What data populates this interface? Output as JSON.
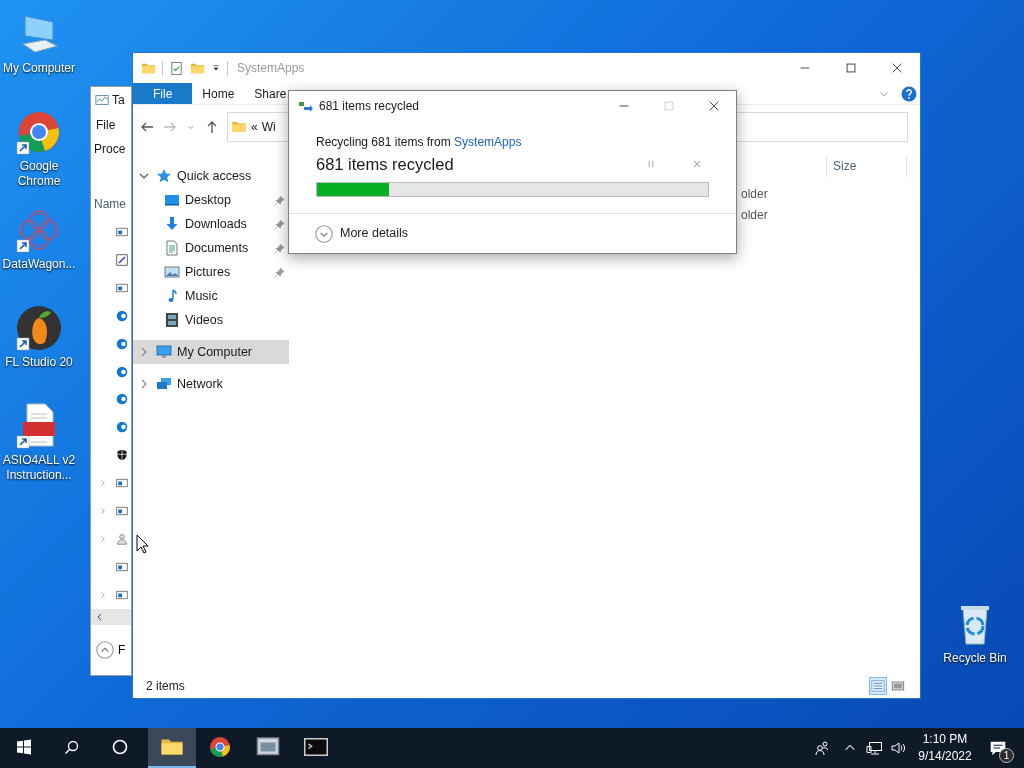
{
  "desktop_icons": [
    {
      "label": "My Computer",
      "kind": "computer",
      "shortcut": false
    },
    {
      "label": "Google Chrome",
      "kind": "chrome",
      "shortcut": true
    },
    {
      "label": "DataWagon...",
      "kind": "pattern",
      "shortcut": true
    },
    {
      "label": "FL Studio 20",
      "kind": "fruit",
      "shortcut": true
    },
    {
      "label": "ASIO4ALL v2 Instruction...",
      "kind": "pdf",
      "shortcut": true
    }
  ],
  "recycle_bin": {
    "label": "Recycle Bin",
    "kind": "recycle"
  },
  "task_manager": {
    "title": "Ta",
    "menu": "File",
    "tab": "Proce",
    "column": "Name",
    "rows": [
      {
        "kind": "app",
        "expandable": false
      },
      {
        "kind": "edit",
        "expandable": false
      },
      {
        "kind": "app",
        "expandable": false
      },
      {
        "kind": "browser",
        "expandable": false
      },
      {
        "kind": "browser",
        "expandable": false
      },
      {
        "kind": "browser",
        "expandable": false
      },
      {
        "kind": "browser",
        "expandable": false
      },
      {
        "kind": "browser",
        "expandable": false
      },
      {
        "kind": "shield",
        "expandable": false
      },
      {
        "kind": "app",
        "expandable": true
      },
      {
        "kind": "app",
        "expandable": true
      },
      {
        "kind": "user",
        "expandable": true
      },
      {
        "kind": "app",
        "expandable": false
      },
      {
        "kind": "app",
        "expandable": true
      }
    ],
    "footer": "F"
  },
  "explorer": {
    "title": "SystemApps",
    "ribbon_tabs": [
      {
        "label": "File",
        "selected": true
      },
      {
        "label": "Home",
        "selected": false
      },
      {
        "label": "Share",
        "selected": false
      }
    ],
    "address": {
      "prefix": "«",
      "text": "Wi"
    },
    "nav": [
      {
        "label": "Quick access",
        "kind": "star",
        "expanded": true,
        "selected": false,
        "children": [
          {
            "label": "Desktop",
            "kind": "desktop",
            "pinned": true,
            "selected": false
          },
          {
            "label": "Downloads",
            "kind": "download",
            "pinned": true,
            "selected": false
          },
          {
            "label": "Documents",
            "kind": "documents",
            "pinned": true,
            "selected": false
          },
          {
            "label": "Pictures",
            "kind": "pictures",
            "pinned": true,
            "selected": false
          },
          {
            "label": "Music",
            "kind": "music",
            "pinned": false,
            "selected": false
          },
          {
            "label": "Videos",
            "kind": "videos",
            "pinned": false,
            "selected": false
          }
        ]
      },
      {
        "label": "My Computer",
        "kind": "computer",
        "expanded": false,
        "selected": true
      },
      {
        "label": "Network",
        "kind": "network",
        "expanded": false,
        "selected": false
      }
    ],
    "columns": [
      "Size"
    ],
    "rows": [
      "older",
      "older"
    ],
    "status": "2 items",
    "views": [
      {
        "kind": "details",
        "selected": true
      },
      {
        "kind": "thumbnails",
        "selected": false
      }
    ]
  },
  "dialog": {
    "title": "681 items recycled",
    "source_text": "Recycling 681 items from ",
    "source_link": "SystemApps",
    "heading": "681 items recycled",
    "progress": {
      "level": 0.185
    },
    "details_label": "More details"
  },
  "taskbar": {
    "apps": [
      {
        "kind": "folder",
        "active": true
      },
      {
        "kind": "chrome",
        "active": false
      },
      {
        "kind": "app",
        "active": false
      },
      {
        "kind": "terminal",
        "active": false
      }
    ],
    "time": "1:10 PM",
    "date": "9/14/2022",
    "notification_count": "1"
  }
}
